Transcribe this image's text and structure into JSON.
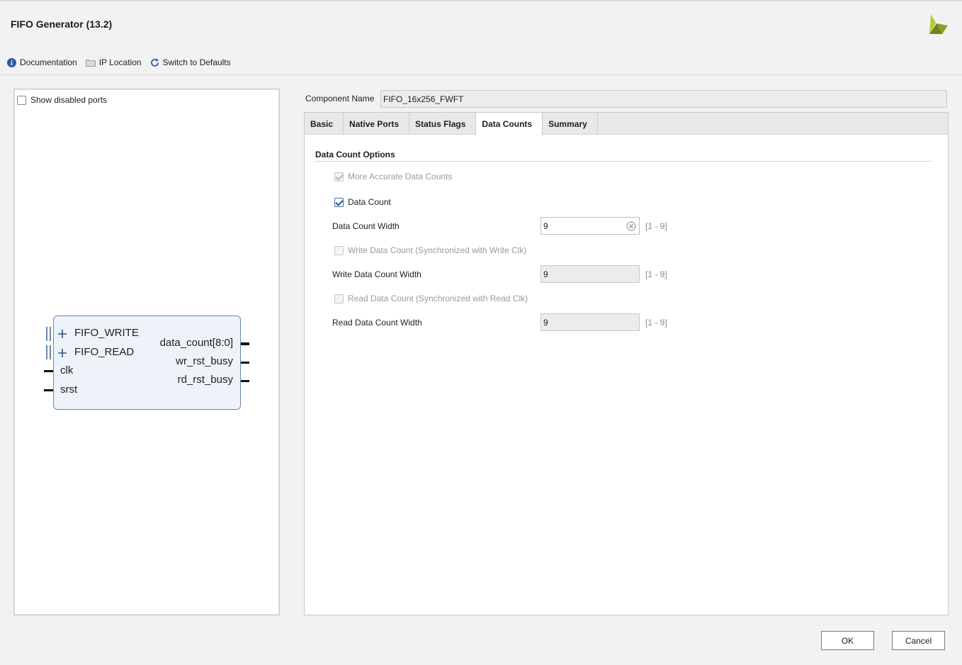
{
  "window": {
    "title": "FIFO Generator (13.2)"
  },
  "toolbar": {
    "documentation": "Documentation",
    "ip_location": "IP Location",
    "switch_defaults": "Switch to Defaults"
  },
  "left_panel": {
    "show_disabled_ports": {
      "label": "Show disabled ports",
      "checked": false
    },
    "symbol": {
      "left_ports": [
        "FIFO_WRITE",
        "FIFO_READ",
        "clk",
        "srst"
      ],
      "right_ports": [
        "data_count[8:0]",
        "wr_rst_busy",
        "rd_rst_busy"
      ]
    }
  },
  "component": {
    "label": "Component Name",
    "value": "FIFO_16x256_FWFT"
  },
  "tabs": [
    "Basic",
    "Native Ports",
    "Status Flags",
    "Data Counts",
    "Summary"
  ],
  "active_tab": "Data Counts",
  "data_counts": {
    "section_title": "Data Count Options",
    "more_accurate": {
      "label": "More Accurate Data Counts",
      "checked": true,
      "enabled": false
    },
    "data_count": {
      "label": "Data Count",
      "checked": true,
      "enabled": true
    },
    "data_count_width": {
      "label": "Data Count Width",
      "value": "9",
      "range": "[1 - 9]",
      "enabled": true
    },
    "write_data_count": {
      "label": "Write Data Count (Synchronized with Write Clk)",
      "checked": false,
      "enabled": false
    },
    "write_data_count_width": {
      "label": "Write Data Count Width",
      "value": "9",
      "range": "[1 - 9]",
      "enabled": false
    },
    "read_data_count": {
      "label": "Read Data Count (Synchronized with Read Clk)",
      "checked": false,
      "enabled": false
    },
    "read_data_count_width": {
      "label": "Read Data Count Width",
      "value": "9",
      "range": "[1 - 9]",
      "enabled": false
    }
  },
  "buttons": {
    "ok": "OK",
    "cancel": "Cancel"
  },
  "colors": {
    "accent": "#2b4f86",
    "symbol_fill": "#eef3f9",
    "symbol_border": "#6d86a8",
    "logo_light": "#a3b82d",
    "logo_dark": "#6b7a1d"
  }
}
